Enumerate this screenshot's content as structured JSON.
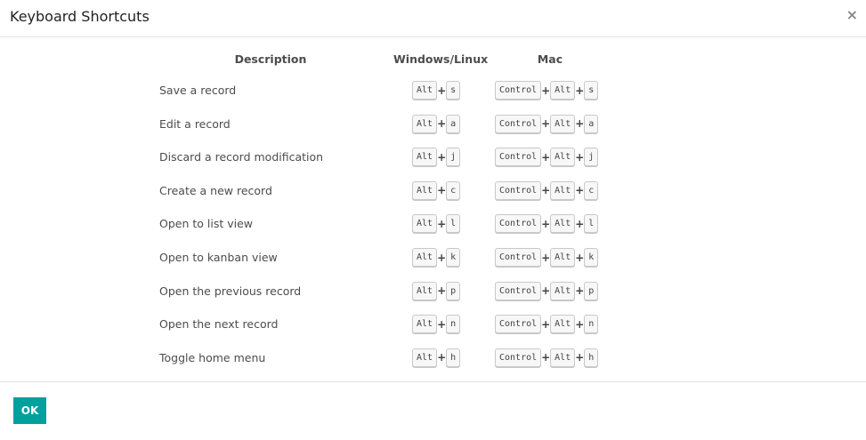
{
  "dialog": {
    "title": "Keyboard Shortcuts",
    "close_label": "×",
    "ok_label": "OK"
  },
  "columns": {
    "description": "Description",
    "windows": "Windows/Linux",
    "mac": "Mac"
  },
  "plus_sign": "+",
  "shortcuts": [
    {
      "description": "Save a record",
      "win": [
        "Alt",
        "s"
      ],
      "mac": [
        "Control",
        "Alt",
        "s"
      ]
    },
    {
      "description": "Edit a record",
      "win": [
        "Alt",
        "a"
      ],
      "mac": [
        "Control",
        "Alt",
        "a"
      ]
    },
    {
      "description": "Discard a record modification",
      "win": [
        "Alt",
        "j"
      ],
      "mac": [
        "Control",
        "Alt",
        "j"
      ]
    },
    {
      "description": "Create a new record",
      "win": [
        "Alt",
        "c"
      ],
      "mac": [
        "Control",
        "Alt",
        "c"
      ]
    },
    {
      "description": "Open to list view",
      "win": [
        "Alt",
        "l"
      ],
      "mac": [
        "Control",
        "Alt",
        "l"
      ]
    },
    {
      "description": "Open to kanban view",
      "win": [
        "Alt",
        "k"
      ],
      "mac": [
        "Control",
        "Alt",
        "k"
      ]
    },
    {
      "description": "Open the previous record",
      "win": [
        "Alt",
        "p"
      ],
      "mac": [
        "Control",
        "Alt",
        "p"
      ]
    },
    {
      "description": "Open the next record",
      "win": [
        "Alt",
        "n"
      ],
      "mac": [
        "Control",
        "Alt",
        "n"
      ]
    },
    {
      "description": "Toggle home menu",
      "win": [
        "Alt",
        "h"
      ],
      "mac": [
        "Control",
        "Alt",
        "h"
      ]
    }
  ]
}
